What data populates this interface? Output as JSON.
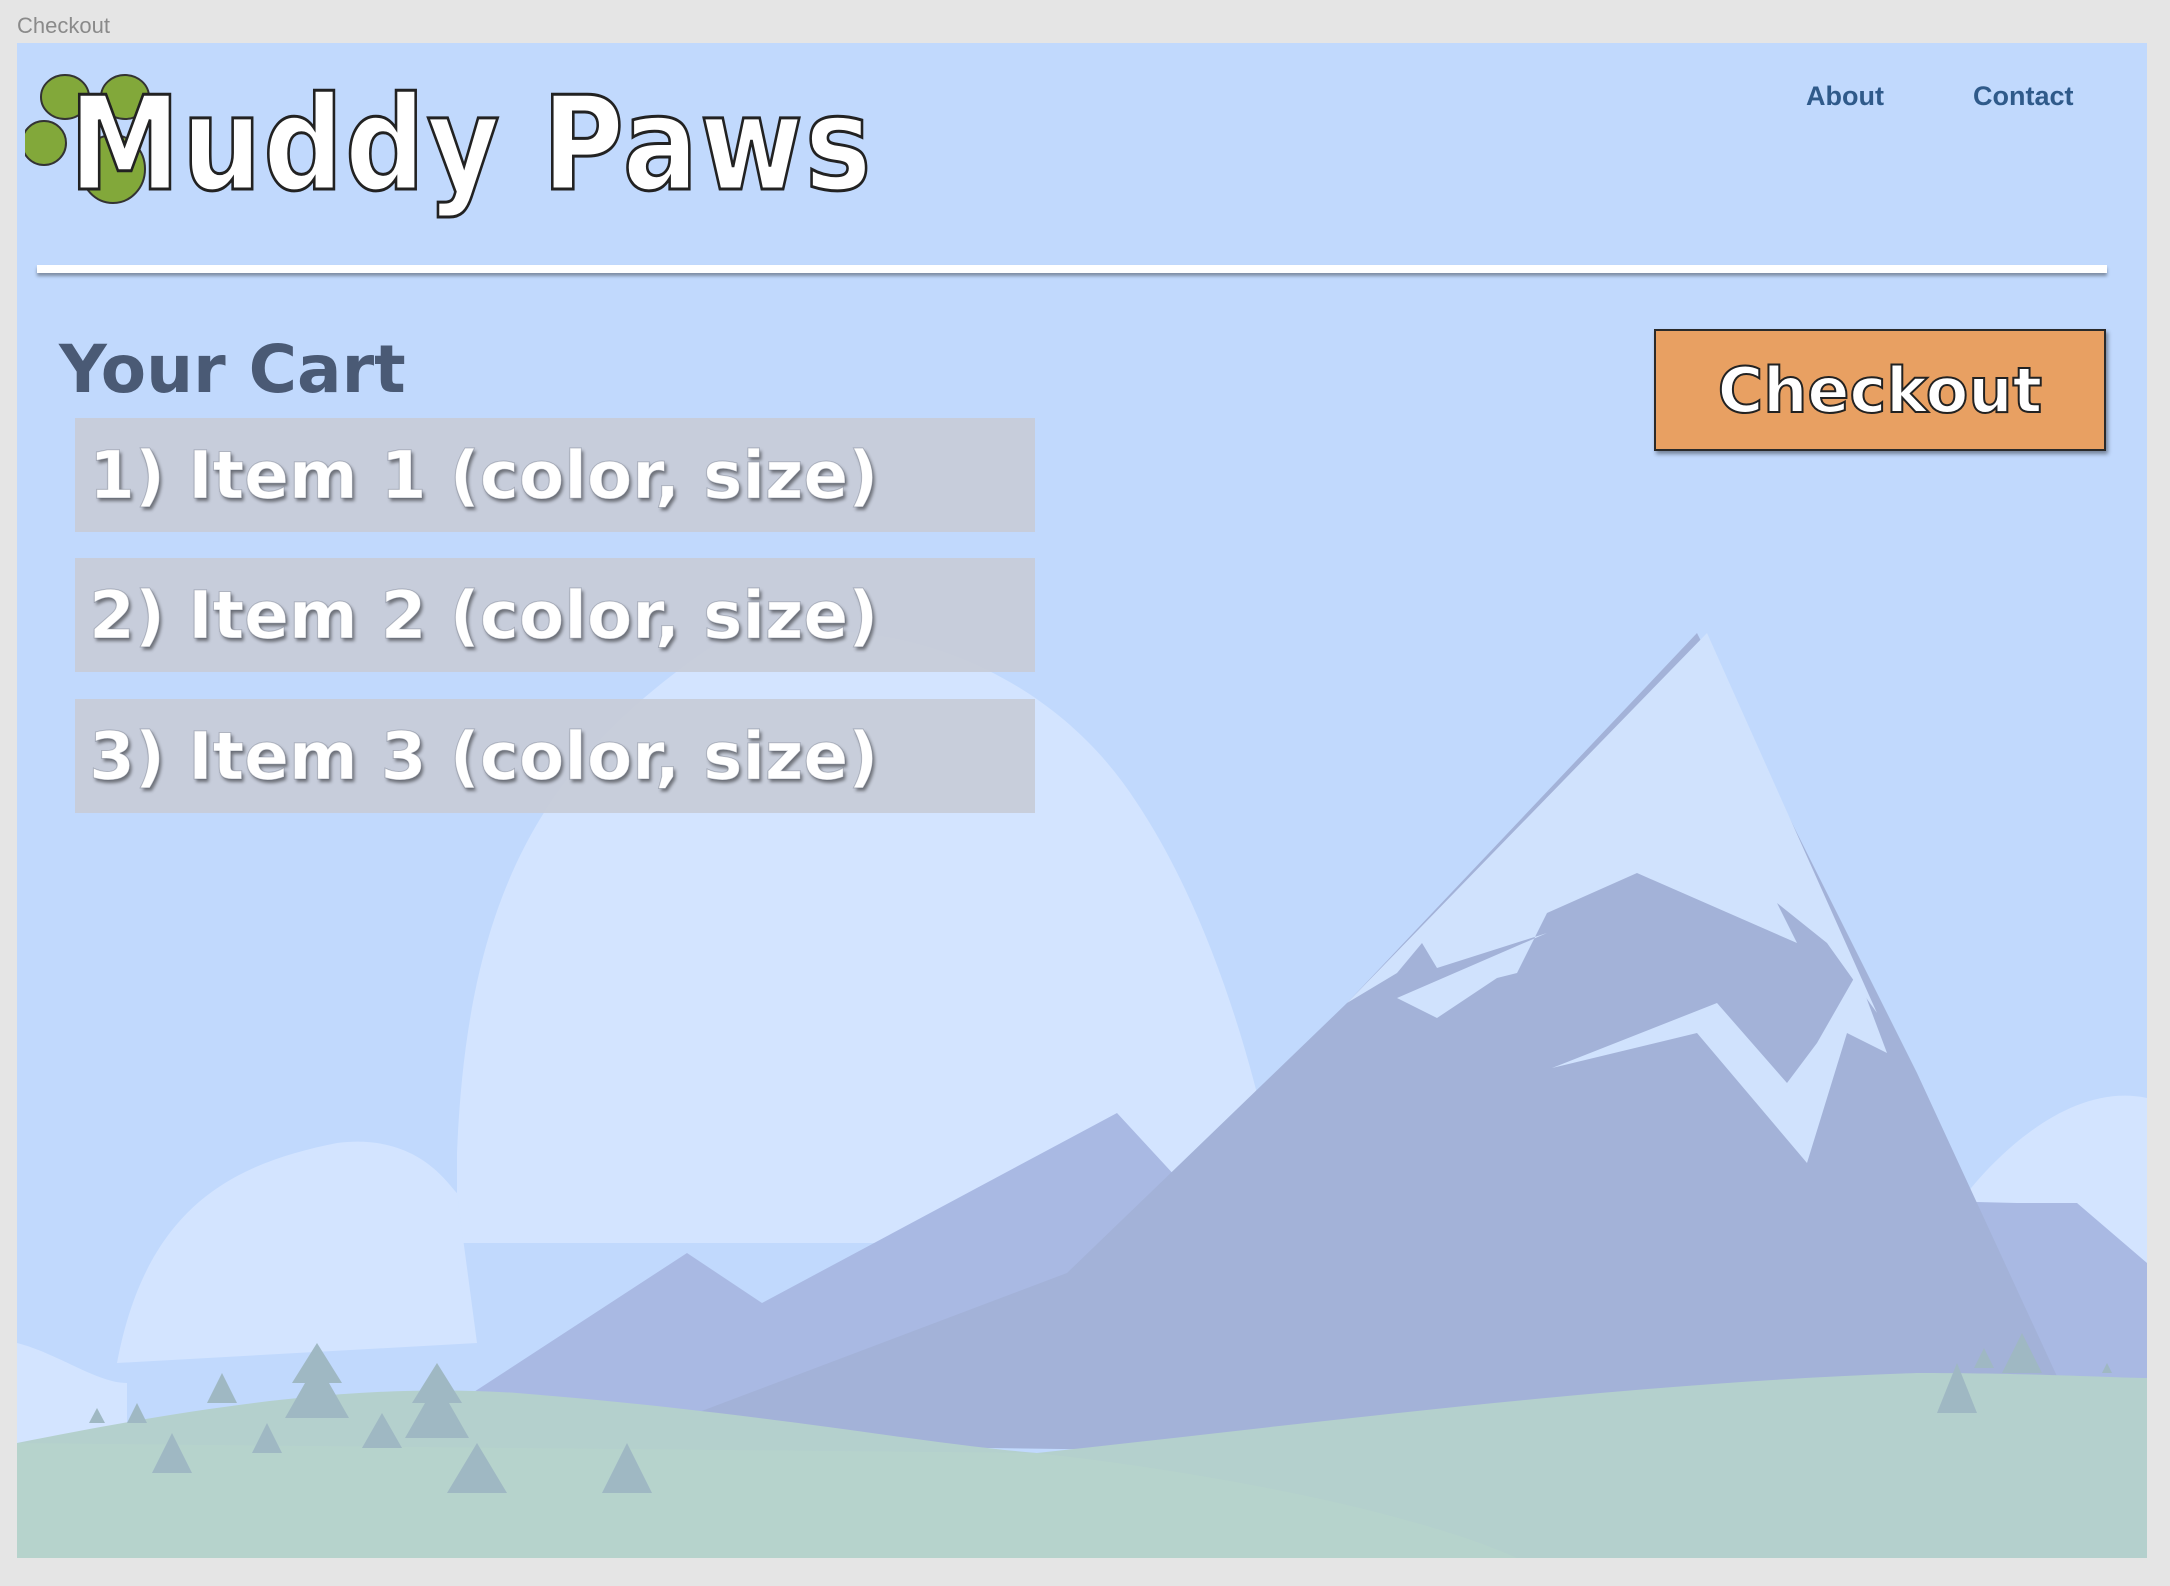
{
  "frame": {
    "label": "Checkout"
  },
  "header": {
    "brand": "Muddy Paws",
    "nav": [
      {
        "label": "About"
      },
      {
        "label": "Contact"
      }
    ]
  },
  "cart": {
    "title": "Your Cart",
    "items": [
      {
        "label": "1) Item 1 (color, size)"
      },
      {
        "label": "2) Item 2 (color, size)"
      },
      {
        "label": "3) Item 3 (color, size)"
      }
    ]
  },
  "checkout": {
    "label": "Checkout"
  },
  "colors": {
    "background": "#c1d9fd",
    "accent_button": "#e8a062",
    "paw_green": "#82a83a",
    "nav_text": "#2f5a8a"
  },
  "icons": {
    "logo": "paw-print-icon"
  }
}
